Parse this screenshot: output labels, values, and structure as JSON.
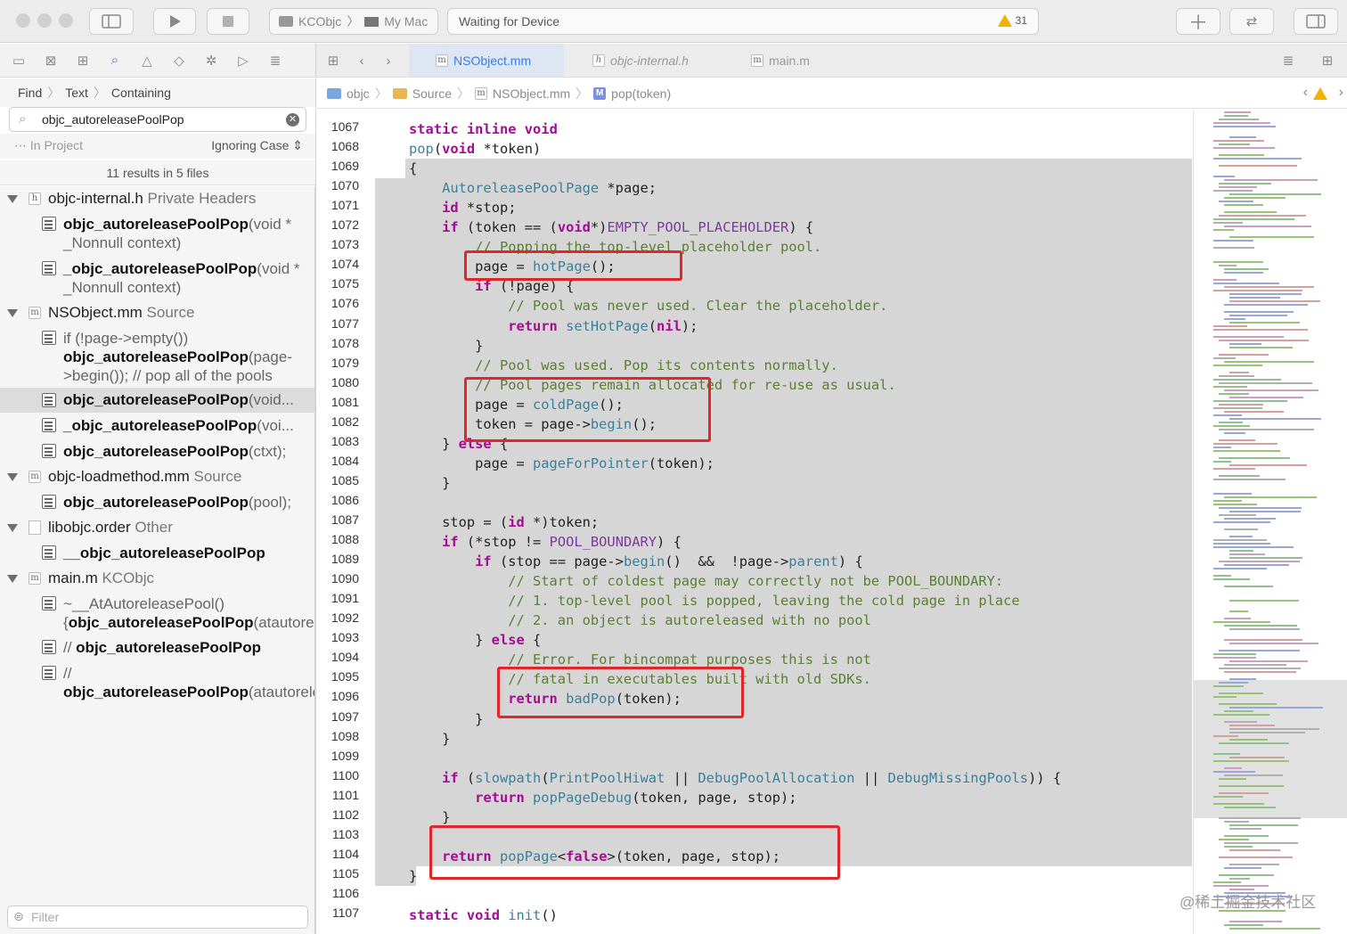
{
  "toolbar": {
    "scheme_project": "KCObjc",
    "scheme_device": "My Mac",
    "status": "Waiting for Device",
    "warning_count": "31"
  },
  "tabs": [
    {
      "label": "NSObject.mm",
      "badge": "m"
    },
    {
      "label": "objc-internal.h",
      "badge": "h"
    },
    {
      "label": "main.m",
      "badge": "m"
    }
  ],
  "find": {
    "breadcrumb": [
      "Find",
      "Text",
      "Containing"
    ],
    "query": "objc_autoreleasePoolPop",
    "scope": "In Project",
    "case_mode": "Ignoring Case",
    "result_summary": "11 results in 5 files",
    "filter_placeholder": "Filter"
  },
  "results": [
    {
      "file": "objc-internal.h",
      "kind": "Private Headers",
      "badge": "h",
      "items": [
        {
          "pre": "",
          "match": "objc_autoreleasePoolPop",
          "post": "(void * _Nonnull context)"
        },
        {
          "pre": "",
          "match": "_objc_autoreleasePoolPop",
          "post": "(void * _Nonnull context)"
        }
      ]
    },
    {
      "file": "NSObject.mm",
      "kind": "Source",
      "badge": "m",
      "items": [
        {
          "pre": "if (!page->empty()) ",
          "match": "objc_autoreleasePoolPop",
          "post": "(page->begin()); // pop all of the pools"
        },
        {
          "pre": "",
          "match": "objc_autoreleasePoolPop",
          "post": "(void..."
        },
        {
          "pre": "",
          "match": "_objc_autoreleasePoolPop",
          "post": "(voi..."
        },
        {
          "pre": "",
          "match": "objc_autoreleasePoolPop",
          "post": "(ctxt);"
        }
      ]
    },
    {
      "file": "objc-loadmethod.mm",
      "kind": "Source",
      "badge": "m",
      "items": [
        {
          "pre": "",
          "match": "objc_autoreleasePoolPop",
          "post": "(pool);"
        }
      ]
    },
    {
      "file": "libobjc.order",
      "kind": "Other",
      "badge": "",
      "items": [
        {
          "pre": "",
          "match": "__objc_autoreleasePoolPop",
          "post": ""
        }
      ]
    },
    {
      "file": "main.m",
      "kind": "KCObjc",
      "badge": "m",
      "items": [
        {
          "pre": "~__AtAutoreleasePool() {",
          "match": "objc_autoreleasePoolPop",
          "post": "(atautorelea..."
        },
        {
          "pre": "// ",
          "match": "objc_autoreleasePoolPop",
          "post": ""
        },
        {
          "pre": "// ",
          "match": "objc_autoreleasePoolPop",
          "post": "(atautoreleasepoolobj);"
        }
      ]
    }
  ],
  "jumpbar": [
    "objc",
    "Source",
    "NSObject.mm",
    "pop(token)"
  ],
  "code_lines": [
    {
      "n": "1067",
      "html": "<span class=\"k\">static</span> <span class=\"k\">inline</span> <span class=\"k\">void</span>"
    },
    {
      "n": "1068",
      "html": "<span class=\"t\">pop</span>(<span class=\"k\">void</span> *token)"
    },
    {
      "n": "1069",
      "html": "{"
    },
    {
      "n": "1070",
      "html": "    <span class=\"t\">AutoreleasePoolPage</span> *page;"
    },
    {
      "n": "1071",
      "html": "    <span class=\"k\">id</span> *stop;"
    },
    {
      "n": "1072",
      "html": "    <span class=\"k\">if</span> (token == (<span class=\"k\">void</span>*)<span class=\"m\">EMPTY_POOL_PLACEHOLDER</span>) {"
    },
    {
      "n": "1073",
      "html": "        <span class=\"c\">// Popping the top-level placeholder pool.</span>"
    },
    {
      "n": "1074",
      "html": "        page = <span class=\"t\">hotPage</span>();"
    },
    {
      "n": "1075",
      "html": "        <span class=\"k\">if</span> (!page) {"
    },
    {
      "n": "1076",
      "html": "            <span class=\"c\">// Pool was never used. Clear the placeholder.</span>"
    },
    {
      "n": "1077",
      "html": "            <span class=\"k\">return</span> <span class=\"t\">setHotPage</span>(<span class=\"k\">nil</span>);"
    },
    {
      "n": "1078",
      "html": "        }"
    },
    {
      "n": "1079",
      "html": "        <span class=\"c\">// Pool was used. Pop its contents normally.</span>"
    },
    {
      "n": "1080",
      "html": "        <span class=\"c\">// Pool pages remain allocated for re-use as usual.</span>"
    },
    {
      "n": "1081",
      "html": "        page = <span class=\"t\">coldPage</span>();"
    },
    {
      "n": "1082",
      "html": "        token = page-&gt;<span class=\"t\">begin</span>();"
    },
    {
      "n": "1083",
      "html": "    } <span class=\"k\">else</span> {"
    },
    {
      "n": "1084",
      "html": "        page = <span class=\"t\">pageForPointer</span>(token);"
    },
    {
      "n": "1085",
      "html": "    }"
    },
    {
      "n": "1086",
      "html": ""
    },
    {
      "n": "1087",
      "html": "    stop = (<span class=\"k\">id</span> *)token;"
    },
    {
      "n": "1088",
      "html": "    <span class=\"k\">if</span> (*stop != <span class=\"m\">POOL_BOUNDARY</span>) {"
    },
    {
      "n": "1089",
      "html": "        <span class=\"k\">if</span> (stop == page-&gt;<span class=\"t\">begin</span>()  &amp;&amp;  !page-&gt;<span class=\"t\">parent</span>) {"
    },
    {
      "n": "1090",
      "html": "            <span class=\"c\">// Start of coldest page may correctly not be POOL_BOUNDARY:</span>"
    },
    {
      "n": "1091",
      "html": "            <span class=\"c\">// 1. top-level pool is popped, leaving the cold page in place</span>"
    },
    {
      "n": "1092",
      "html": "            <span class=\"c\">// 2. an object is autoreleased with no pool</span>"
    },
    {
      "n": "1093",
      "html": "        } <span class=\"k\">else</span> {"
    },
    {
      "n": "1094",
      "html": "            <span class=\"c\">// Error. For bincompat purposes this is not</span>"
    },
    {
      "n": "1095",
      "html": "            <span class=\"c\">// fatal in executables built with old SDKs.</span>"
    },
    {
      "n": "1096",
      "html": "            <span class=\"k\">return</span> <span class=\"t\">badPop</span>(token);"
    },
    {
      "n": "1097",
      "html": "        }"
    },
    {
      "n": "1098",
      "html": "    }"
    },
    {
      "n": "1099",
      "html": ""
    },
    {
      "n": "1100",
      "html": "    <span class=\"k\">if</span> (<span class=\"t\">slowpath</span>(<span class=\"t\">PrintPoolHiwat</span> || <span class=\"t\">DebugPoolAllocation</span> || <span class=\"t\">DebugMissingPools</span>)) {"
    },
    {
      "n": "1101",
      "html": "        <span class=\"k\">return</span> <span class=\"t\">popPageDebug</span>(token, page, stop);"
    },
    {
      "n": "1102",
      "html": "    }"
    },
    {
      "n": "1103",
      "html": ""
    },
    {
      "n": "1104",
      "html": "    <span class=\"k\">return</span> <span class=\"t\">popPage</span>&lt;<span class=\"k\">false</span>&gt;(token, page, stop);"
    },
    {
      "n": "1105",
      "html": "}"
    },
    {
      "n": "1106",
      "html": ""
    },
    {
      "n": "1107",
      "html": "<span class=\"k\">static</span> <span class=\"k\">void</span> <span class=\"t\">init</span>()"
    }
  ],
  "watermark": "@稀土掘金技术社区",
  "colors": {
    "accent": "#3b7be0",
    "keyword": "#a30c92",
    "comment": "#5a7f33",
    "highlight_box": "#e0262c",
    "warning": "#f0b400"
  },
  "icons": [
    "sidebar-toggle-icon",
    "play-icon",
    "stop-icon",
    "plus-icon",
    "swap-icon",
    "inspector-toggle-icon",
    "folder-icon",
    "x-square-icon",
    "hierarchy-icon",
    "search-icon",
    "warning-icon",
    "diamond-icon",
    "bug-icon",
    "tag-icon",
    "report-icon",
    "grid-icon",
    "chevron-left-icon",
    "chevron-right-icon"
  ]
}
